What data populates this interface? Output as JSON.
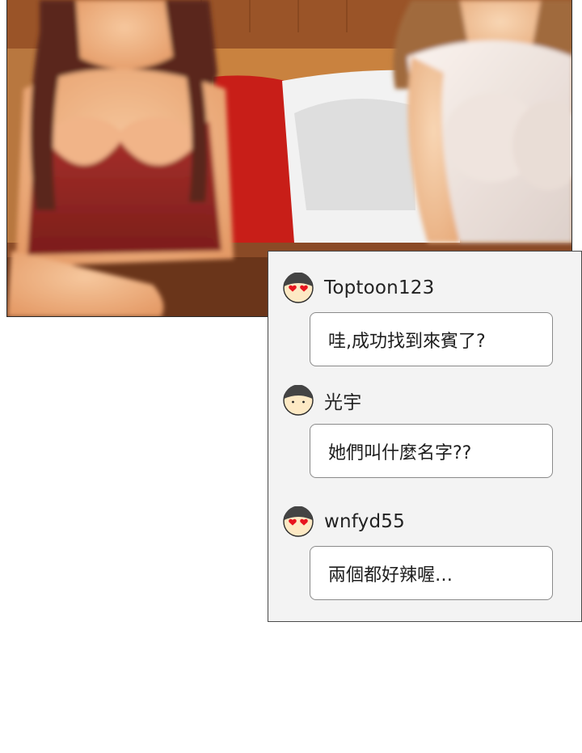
{
  "comments": [
    {
      "username": "Toptoon123",
      "avatar_icon": "avatar-heart-eyes-icon",
      "text": "哇,成功找到來賓了?"
    },
    {
      "username": "光宇",
      "avatar_icon": "avatar-neutral-face-icon",
      "text": "她們叫什麼名字??"
    },
    {
      "username": "wnfyd55",
      "avatar_icon": "avatar-heart-eyes-icon",
      "text": "兩個都好辣喔…"
    }
  ],
  "colors": {
    "card_background": "#f3f3f3",
    "bubble_background": "#ffffff",
    "heart_eyes": "#e8141e",
    "avatar_face": "#fde9c4"
  }
}
